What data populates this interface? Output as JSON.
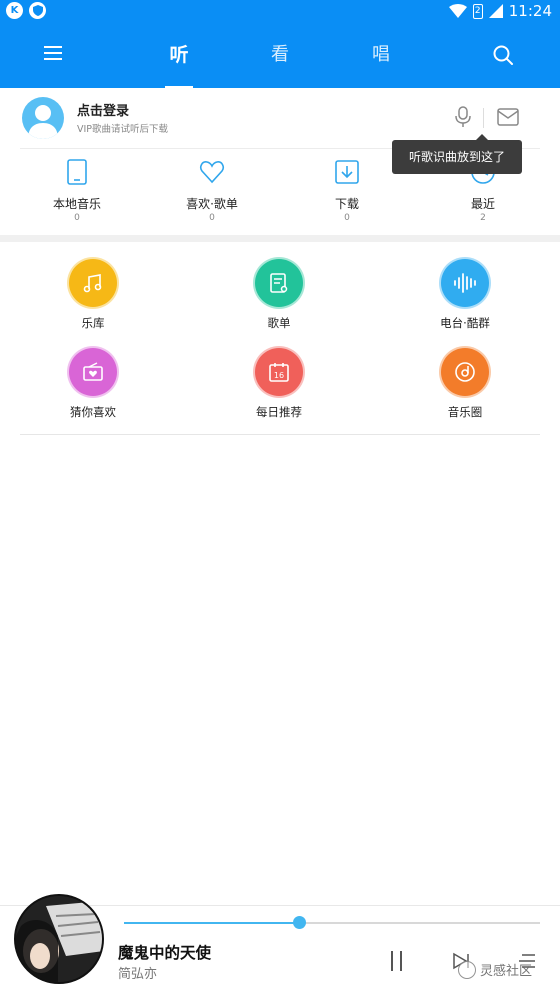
{
  "status_bar": {
    "badge_k": "K",
    "battery_digit": "2",
    "time": "11:24"
  },
  "header": {
    "tabs": [
      {
        "label": "听"
      },
      {
        "label": "看"
      },
      {
        "label": "唱"
      }
    ],
    "active_tab": "听",
    "menu_icon": "hamburger-menu-icon",
    "search_icon": "search-icon"
  },
  "account": {
    "login_title": "点击登录",
    "login_subtitle": "VIP歌曲请试听后下载",
    "mic_icon": "microphone-icon",
    "mail_icon": "mail-icon"
  },
  "tooltip": {
    "text": "听歌识曲放到这了"
  },
  "quick_access": [
    {
      "label": "本地音乐",
      "count": "0",
      "icon": "phone-icon"
    },
    {
      "label": "喜欢·歌单",
      "count": "0",
      "icon": "heart-icon"
    },
    {
      "label": "下载",
      "count": "0",
      "icon": "download-icon"
    },
    {
      "label": "最近",
      "count": "2",
      "icon": "clock-icon"
    }
  ],
  "categories": [
    {
      "label": "乐库",
      "icon": "music-note-icon",
      "color": "#f6b816"
    },
    {
      "label": "歌单",
      "icon": "songlist-icon",
      "color": "#22c39a"
    },
    {
      "label": "电台·酷群",
      "icon": "soundwave-icon",
      "color": "#30acf0"
    },
    {
      "label": "猜你喜欢",
      "icon": "radio-heart-icon",
      "color": "#d965d6"
    },
    {
      "label": "每日推荐",
      "icon": "calendar-icon",
      "color": "#f0605a"
    },
    {
      "label": "音乐圈",
      "icon": "disc-icon",
      "color": "#f37c2a"
    }
  ],
  "player": {
    "song_title": "魔鬼中的天使",
    "artist": "简弘亦",
    "progress": 0.42
  },
  "watermark": {
    "text": "灵感社区"
  },
  "colors": {
    "primary": "#0a8ef5",
    "accent": "#42b6f0"
  }
}
